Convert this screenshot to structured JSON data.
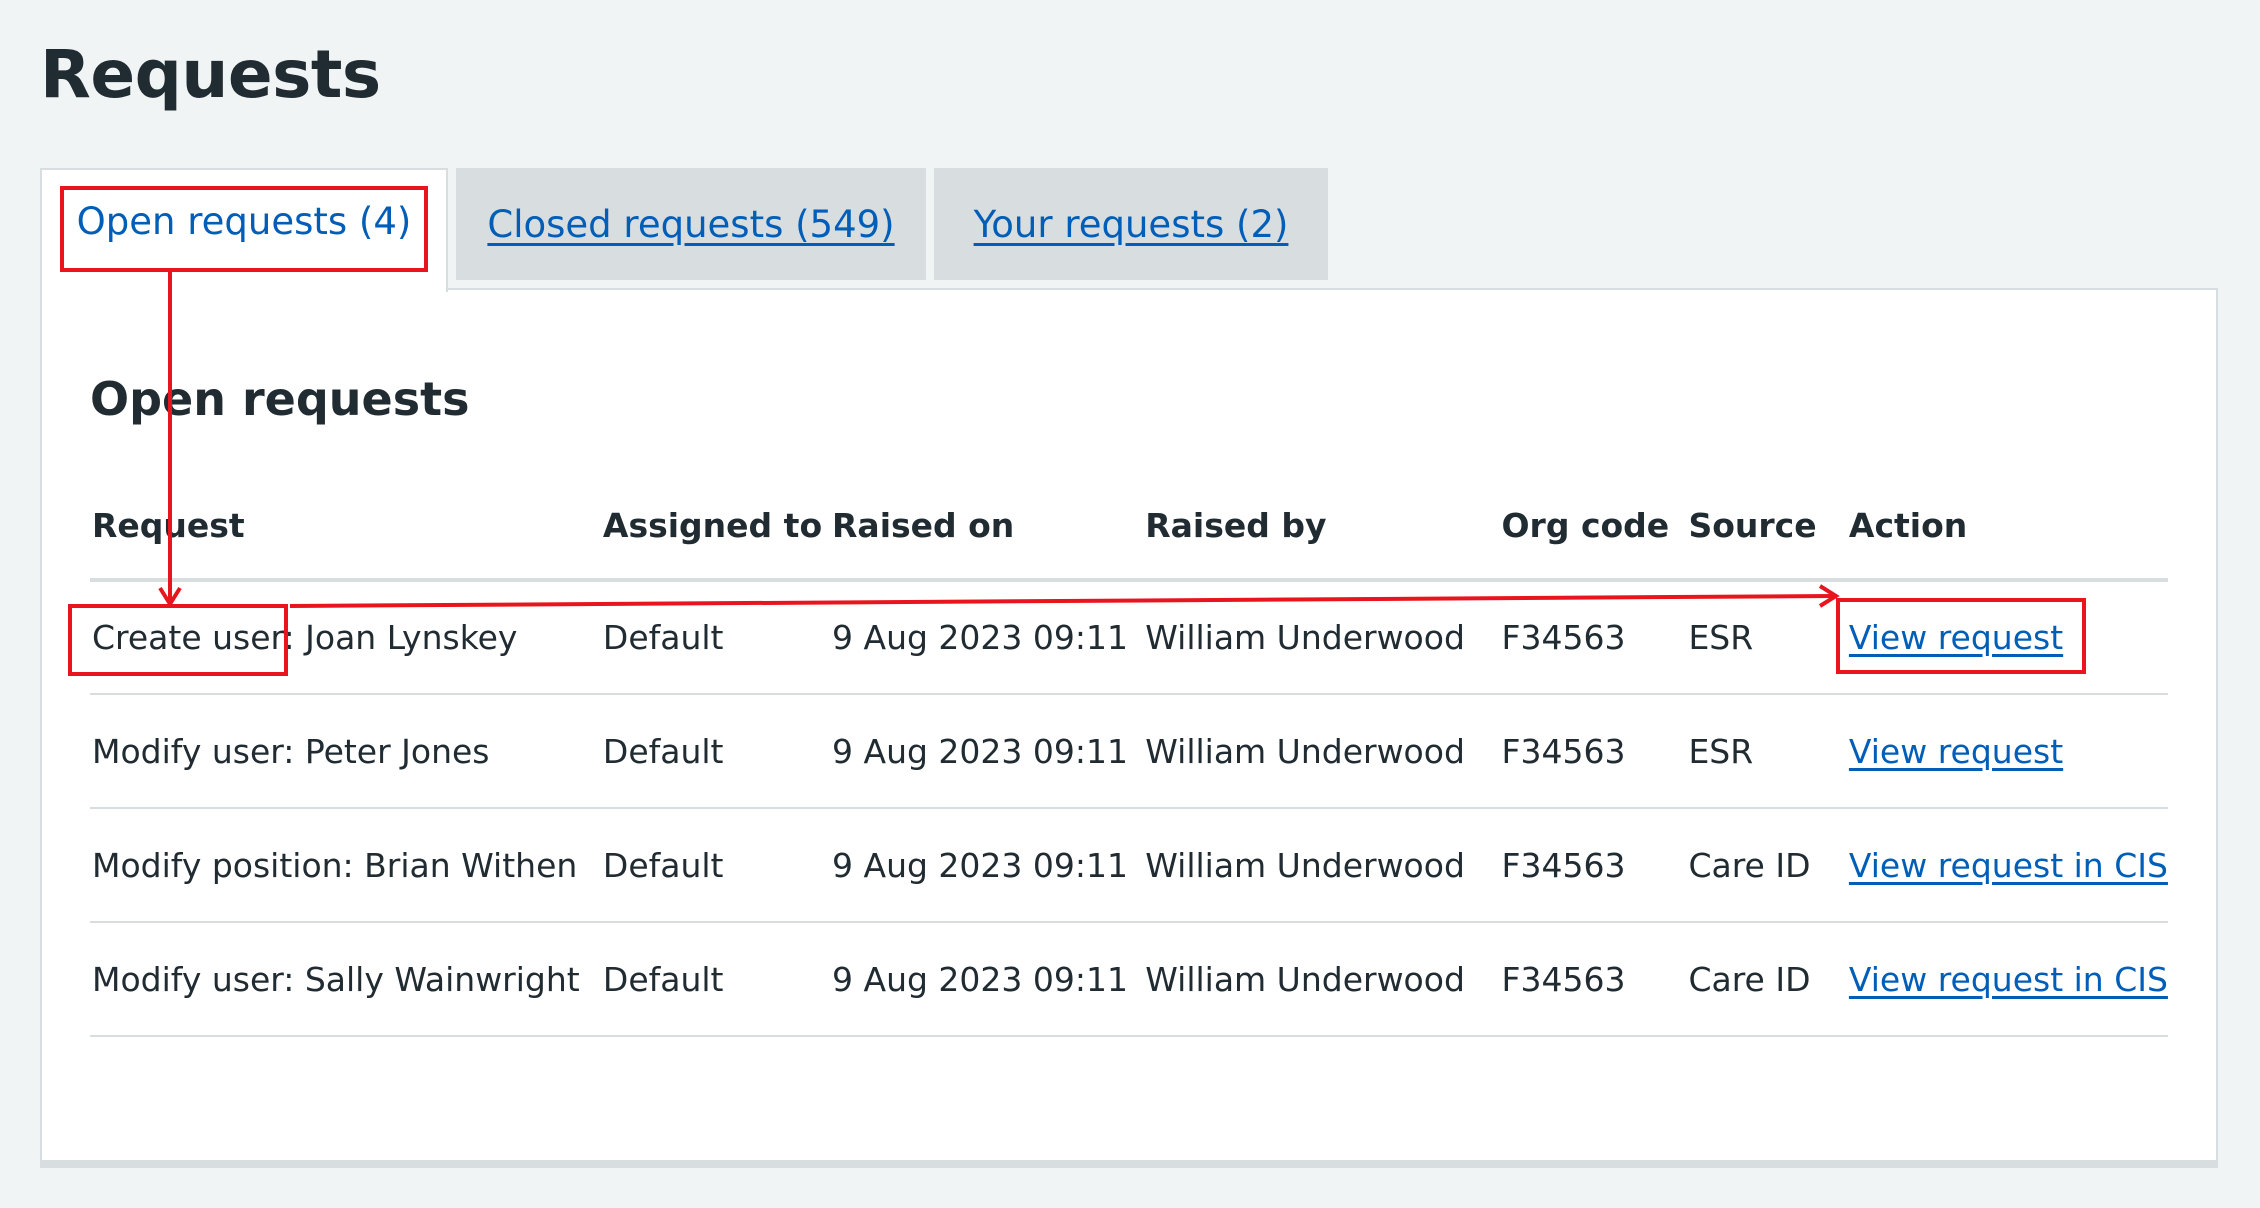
{
  "page": {
    "title": "Requests"
  },
  "tabs": [
    {
      "label": "Open requests (4)",
      "active": true
    },
    {
      "label": "Closed requests (549)",
      "active": false
    },
    {
      "label": "Your requests (2)",
      "active": false
    }
  ],
  "panel": {
    "heading": "Open requests"
  },
  "table": {
    "headers": [
      "Request",
      "Assigned to",
      "Raised on",
      "Raised by",
      "Org code",
      "Source",
      "Action"
    ],
    "rows": [
      {
        "request": "Create user: Joan Lynskey",
        "assigned_to": "Default",
        "raised_on": "9 Aug 2023 09:11",
        "raised_by": "William Underwood",
        "org_code": "F34563",
        "source": "ESR",
        "action": "View request"
      },
      {
        "request": "Modify user: Peter Jones",
        "assigned_to": "Default",
        "raised_on": "9 Aug 2023 09:11",
        "raised_by": "William Underwood",
        "org_code": "F34563",
        "source": "ESR",
        "action": "View request"
      },
      {
        "request": "Modify position: Brian Withen",
        "assigned_to": "Default",
        "raised_on": "9 Aug 2023 09:11",
        "raised_by": "William Underwood",
        "org_code": "F34563",
        "source": "Care ID",
        "action": "View request in CIS"
      },
      {
        "request": "Modify user: Sally Wainwright",
        "assigned_to": "Default",
        "raised_on": "9 Aug 2023 09:11",
        "raised_by": "William Underwood",
        "org_code": "F34563",
        "source": "Care ID",
        "action": "View request in CIS"
      }
    ]
  },
  "colors": {
    "link": "#005eb8",
    "annotation": "#e8141e",
    "tab_inactive_bg": "#d8dde0",
    "page_bg": "#f0f4f5"
  }
}
